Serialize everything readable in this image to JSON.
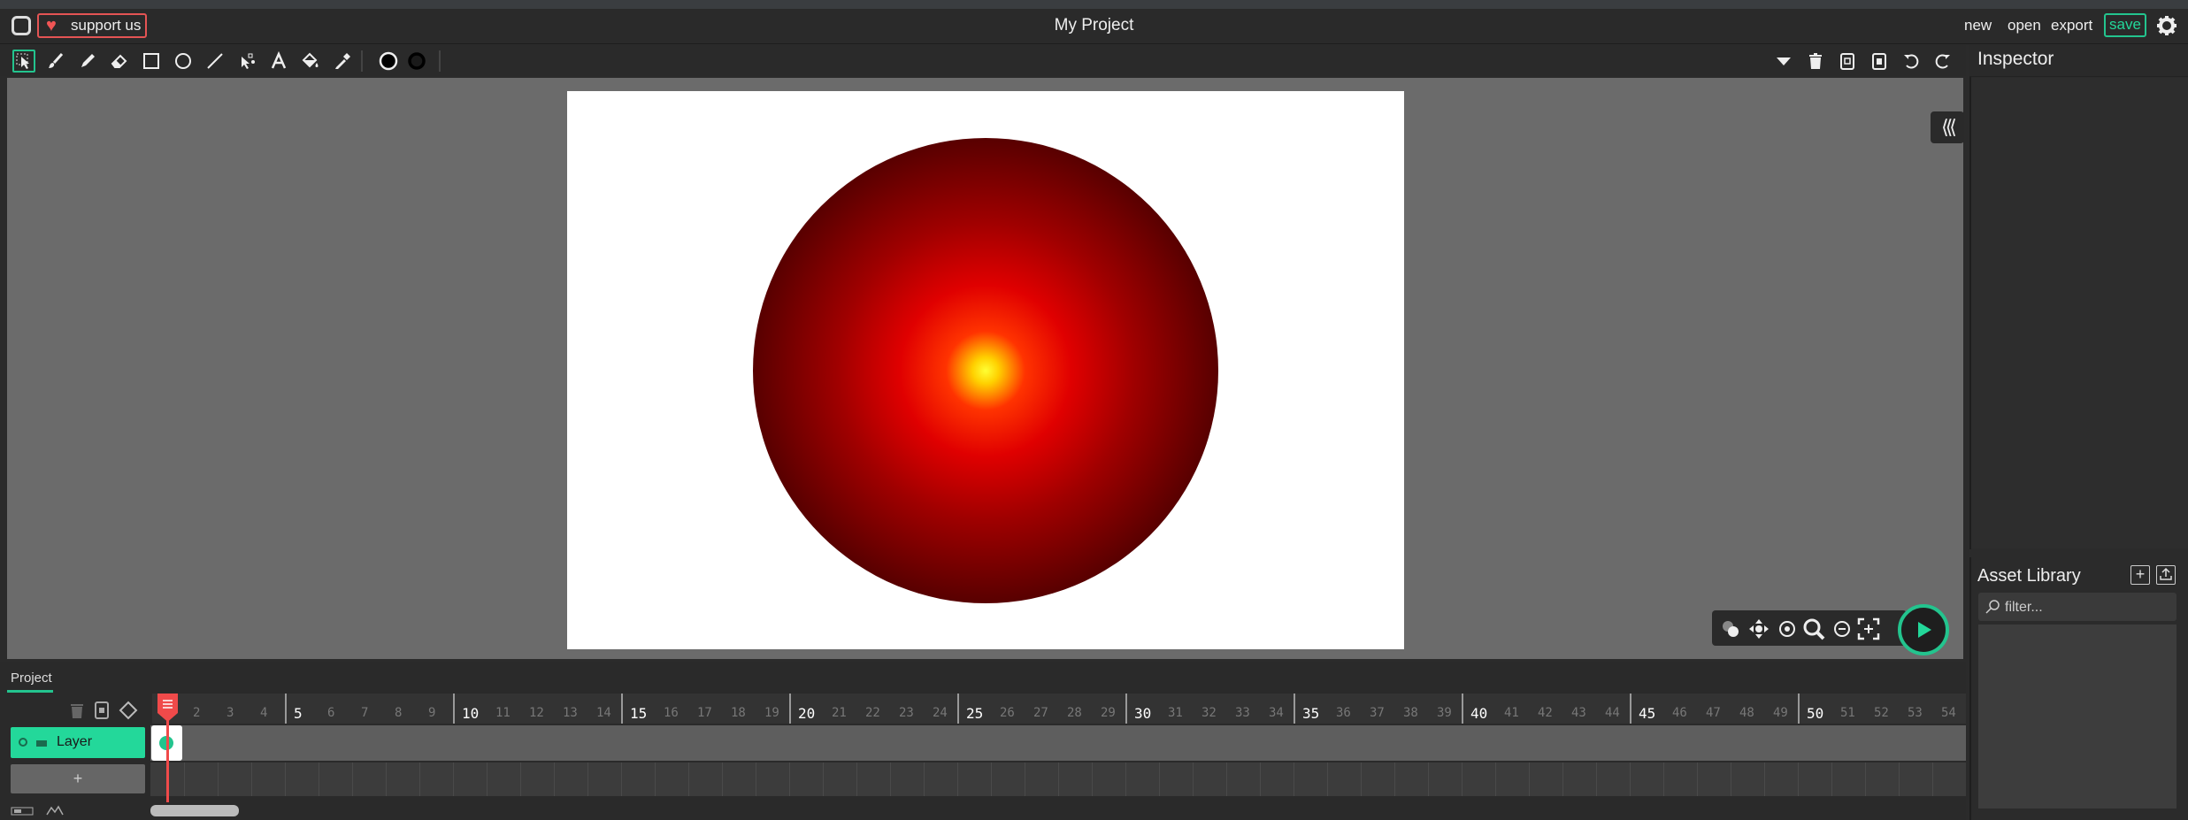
{
  "window": {
    "title": "My Project",
    "support_label": "support us"
  },
  "menu": {
    "new": "new",
    "open": "open",
    "export": "export",
    "save": "save"
  },
  "toolbar": {
    "tools": [
      "select-icon",
      "brush-icon",
      "pencil-icon",
      "eraser-icon",
      "rectangle-icon",
      "ellipse-icon",
      "line-icon",
      "path-icon",
      "text-icon",
      "fill-bucket-icon",
      "eyedropper-icon",
      "fill-color-swatch",
      "stroke-color-swatch"
    ],
    "right_tools": [
      "dropdown-icon",
      "delete-icon",
      "copy-icon",
      "paste-icon",
      "undo-icon",
      "redo-icon"
    ]
  },
  "panels": {
    "inspector_title": "Inspector",
    "asset_library_title": "Asset Library",
    "asset_filter_placeholder": "filter..."
  },
  "timeline": {
    "tab_label": "Project",
    "layer_name": "Layer",
    "add_layer_label": "+",
    "frames": [
      "2",
      "3",
      "4",
      "5",
      "6",
      "7",
      "8",
      "9",
      "10",
      "11",
      "12",
      "13",
      "14",
      "15",
      "16",
      "17",
      "18",
      "19",
      "20",
      "21",
      "22",
      "23",
      "24",
      "25",
      "26",
      "27",
      "28",
      "29",
      "30",
      "31",
      "32",
      "33",
      "34",
      "35",
      "36",
      "37",
      "38",
      "39",
      "40",
      "41",
      "42",
      "43",
      "44",
      "45",
      "46",
      "47",
      "48",
      "49",
      "50",
      "51",
      "52",
      "53",
      "54"
    ],
    "current_frame": 1
  },
  "colors": {
    "accent": "#23c48e",
    "support": "#e45454",
    "playhead": "#f04a4a",
    "stage_background": "#6b6b6b",
    "canvas": "#ffffff"
  }
}
